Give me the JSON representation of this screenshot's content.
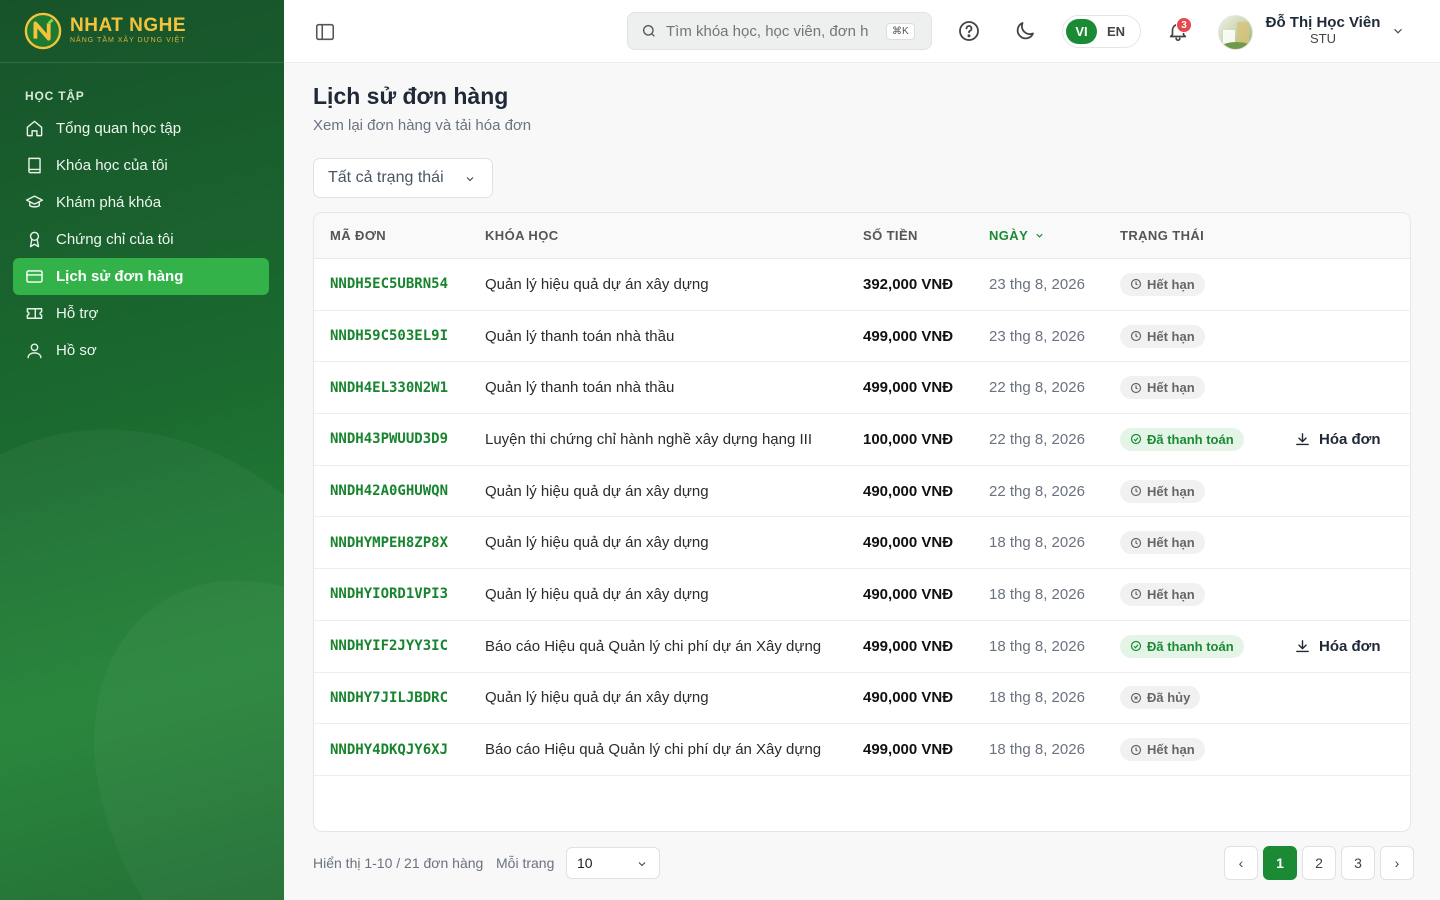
{
  "brand": {
    "name": "NHAT NGHE",
    "tagline": "NÂNG TẦM XÂY DỰNG VIỆT"
  },
  "sidebar": {
    "section_title": "HỌC TẬP",
    "items": [
      {
        "label": "Tổng quan học tập",
        "icon": "home-icon"
      },
      {
        "label": "Khóa học của tôi",
        "icon": "book-icon"
      },
      {
        "label": "Khám phá khóa",
        "icon": "graduation-cap-icon"
      },
      {
        "label": "Chứng chỉ của tôi",
        "icon": "award-icon"
      },
      {
        "label": "Lịch sử đơn hàng",
        "icon": "credit-card-icon",
        "active": true
      },
      {
        "label": "Hỗ trợ",
        "icon": "ticket-icon"
      },
      {
        "label": "Hồ sơ",
        "icon": "user-icon"
      }
    ]
  },
  "header": {
    "search_placeholder": "Tìm khóa học, học viên, đơn h",
    "search_shortcut": "⌘K",
    "lang_active": "VI",
    "lang_other": "EN",
    "notification_count": "3",
    "user_name": "Đỗ Thị Học Viên",
    "user_role": "STU"
  },
  "page": {
    "title": "Lịch sử đơn hàng",
    "subtitle": "Xem lại đơn hàng và tải hóa đơn",
    "filter_label": "Tất cả trạng thái"
  },
  "table": {
    "headers": {
      "code": "MÃ ĐƠN",
      "course": "KHÓA HỌC",
      "amount": "SỐ TIỀN",
      "date": "NGÀY",
      "status": "TRẠNG THÁI"
    },
    "invoice_label": "Hóa đơn",
    "rows": [
      {
        "code": "NNDH5EC5UBRN54",
        "course": "Quản lý hiệu quả dự án xây dựng",
        "amount": "392,000 VNĐ",
        "date": "23 thg 8, 2026",
        "status": "Hết hạn",
        "status_type": "expired",
        "invoice": false
      },
      {
        "code": "NNDH59C503EL9I",
        "course": "Quản lý thanh toán nhà thầu",
        "amount": "499,000 VNĐ",
        "date": "23 thg 8, 2026",
        "status": "Hết hạn",
        "status_type": "expired",
        "invoice": false
      },
      {
        "code": "NNDH4EL330N2W1",
        "course": "Quản lý thanh toán nhà thầu",
        "amount": "499,000 VNĐ",
        "date": "22 thg 8, 2026",
        "status": "Hết hạn",
        "status_type": "expired",
        "invoice": false
      },
      {
        "code": "NNDH43PWUUD3D9",
        "course": "Luyện thi chứng chỉ hành nghề xây dựng hạng III",
        "amount": "100,000 VNĐ",
        "date": "22 thg 8, 2026",
        "status": "Đã thanh toán",
        "status_type": "paid",
        "invoice": true
      },
      {
        "code": "NNDH42A0GHUWQN",
        "course": "Quản lý hiệu quả dự án xây dựng",
        "amount": "490,000 VNĐ",
        "date": "22 thg 8, 2026",
        "status": "Hết hạn",
        "status_type": "expired",
        "invoice": false
      },
      {
        "code": "NNDHYMPEH8ZP8X",
        "course": "Quản lý hiệu quả dự án xây dựng",
        "amount": "490,000 VNĐ",
        "date": "18 thg 8, 2026",
        "status": "Hết hạn",
        "status_type": "expired",
        "invoice": false
      },
      {
        "code": "NNDHYIORD1VPI3",
        "course": "Quản lý hiệu quả dự án xây dựng",
        "amount": "490,000 VNĐ",
        "date": "18 thg 8, 2026",
        "status": "Hết hạn",
        "status_type": "expired",
        "invoice": false
      },
      {
        "code": "NNDHYIF2JYY3IC",
        "course": "Báo cáo Hiệu quả Quản lý chi phí dự án Xây dựng",
        "amount": "499,000 VNĐ",
        "date": "18 thg 8, 2026",
        "status": "Đã thanh toán",
        "status_type": "paid",
        "invoice": true
      },
      {
        "code": "NNDHY7JILJBDRC",
        "course": "Quản lý hiệu quả dự án xây dựng",
        "amount": "490,000 VNĐ",
        "date": "18 thg 8, 2026",
        "status": "Đã hủy",
        "status_type": "cancelled",
        "invoice": false
      },
      {
        "code": "NNDHY4DKQJY6XJ",
        "course": "Báo cáo Hiệu quả Quản lý chi phí dự án Xây dựng",
        "amount": "499,000 VNĐ",
        "date": "18 thg 8, 2026",
        "status": "Hết hạn",
        "status_type": "expired",
        "invoice": false
      }
    ]
  },
  "footer": {
    "showing": "Hiển thị 1-10 / 21 đơn hàng",
    "per_page_label": "Mỗi trang",
    "per_page_value": "10",
    "pages": [
      "1",
      "2",
      "3"
    ],
    "prev": "‹",
    "next": "›"
  },
  "colors": {
    "brand_green": "#1a8a34",
    "active_nav": "#34b24a",
    "logo_gold": "#f5c33b"
  }
}
